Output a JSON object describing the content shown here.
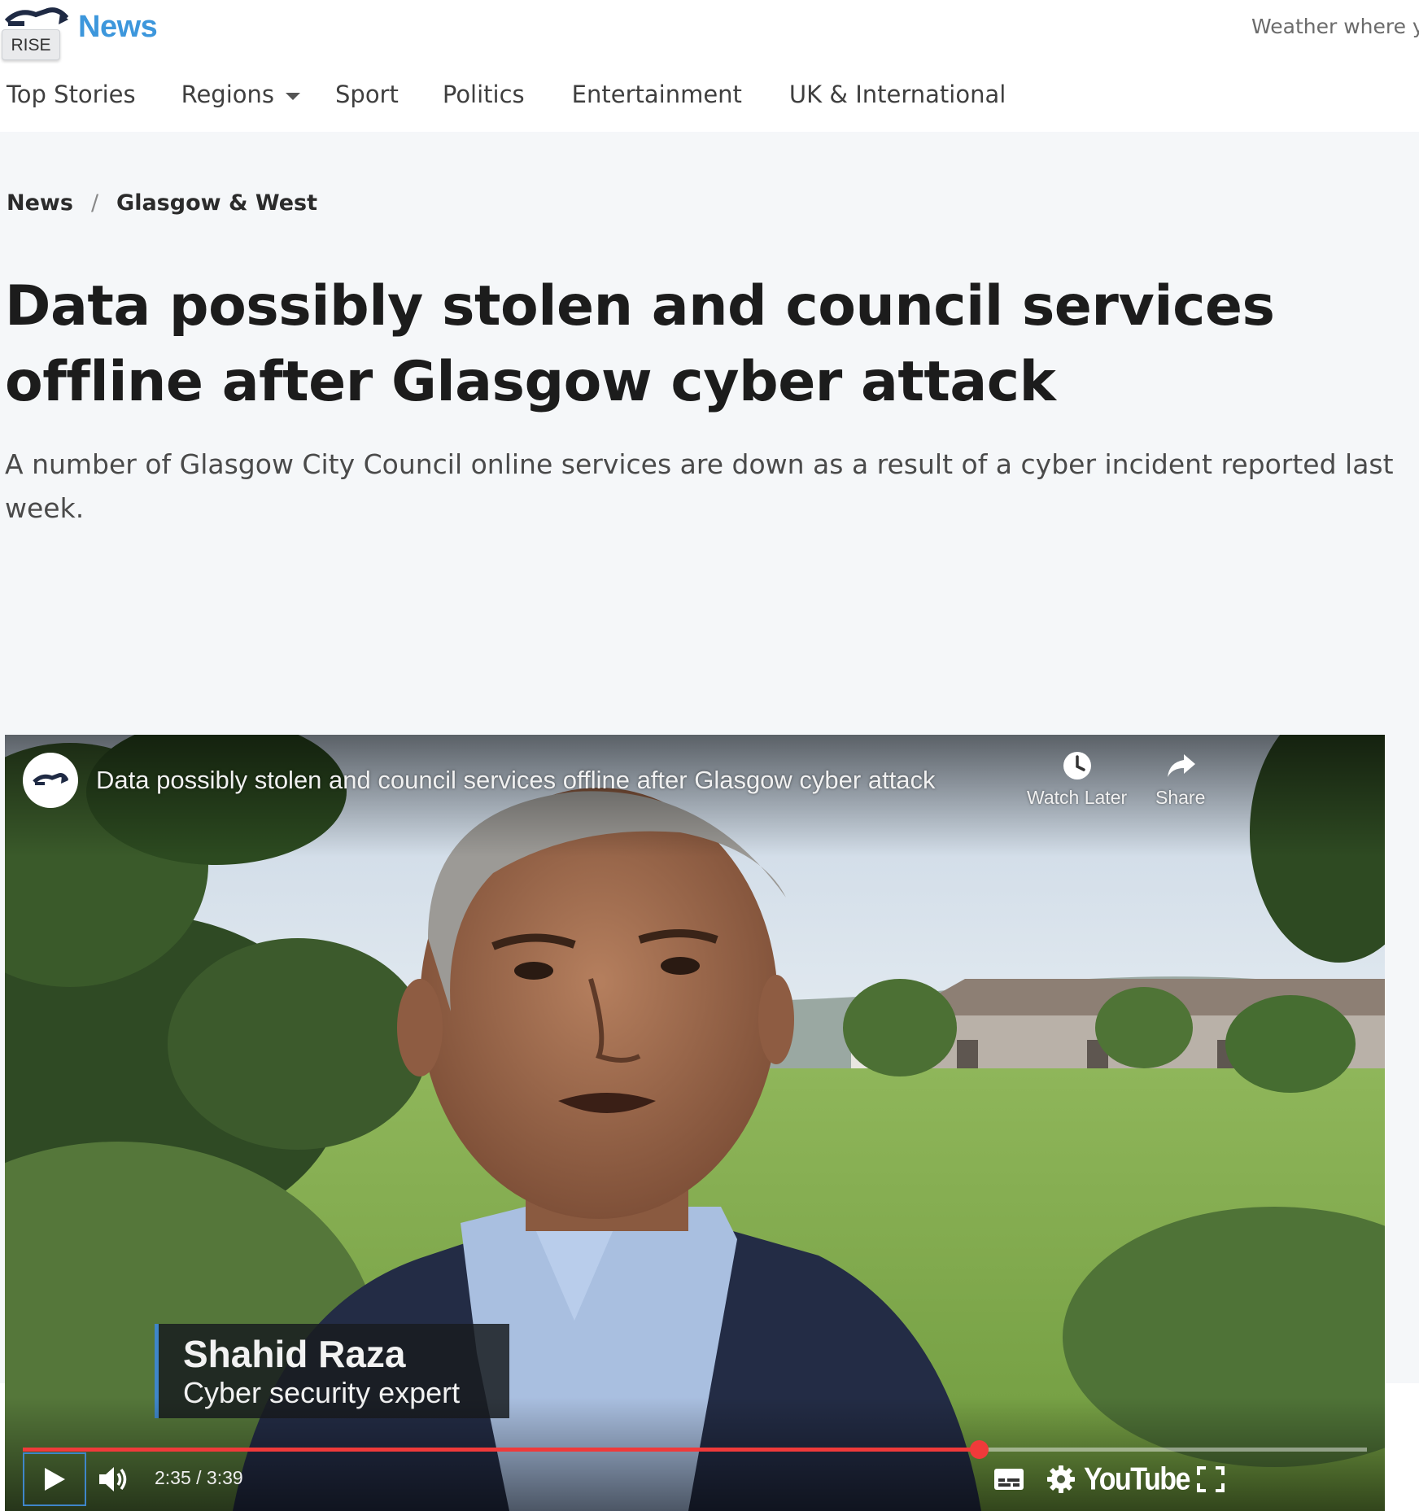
{
  "header": {
    "brand_label": "News",
    "badge_label": "RISE",
    "weather_label": "Weather where y"
  },
  "nav": {
    "items": [
      {
        "label": "Top Stories"
      },
      {
        "label": "Regions",
        "has_dropdown": true
      },
      {
        "label": "Sport"
      },
      {
        "label": "Politics"
      },
      {
        "label": "Entertainment"
      },
      {
        "label": "UK & International"
      }
    ]
  },
  "breadcrumb": {
    "items": [
      "News",
      "Glasgow & West"
    ],
    "separator": "/"
  },
  "article": {
    "headline": "Data possibly stolen and council services offline after Glasgow cyber attack",
    "standfirst": "A number of Glasgow City Council online services are down as a result of a cyber incident reported last week."
  },
  "video": {
    "title": "Data possibly stolen and council services offline after Glasgow cyber attack",
    "watch_later_label": "Watch Later",
    "share_label": "Share",
    "lower_third": {
      "name": "Shahid Raza",
      "role": "Cyber security expert"
    },
    "time_display": "2:35 / 3:39",
    "progress": 0.712,
    "platform_label": "YouTube",
    "icons": {
      "play": "play-icon",
      "volume": "volume-icon",
      "subtitles": "subtitles-icon",
      "settings": "gear-icon",
      "fullscreen": "fullscreen-icon",
      "watch_later": "clock-icon",
      "share": "share-arrow-icon"
    }
  },
  "colors": {
    "brand_blue": "#3d97dc",
    "progress_red": "#f03a3a",
    "page_bg": "#f5f7f9",
    "focus_outline": "#3f86c9"
  }
}
